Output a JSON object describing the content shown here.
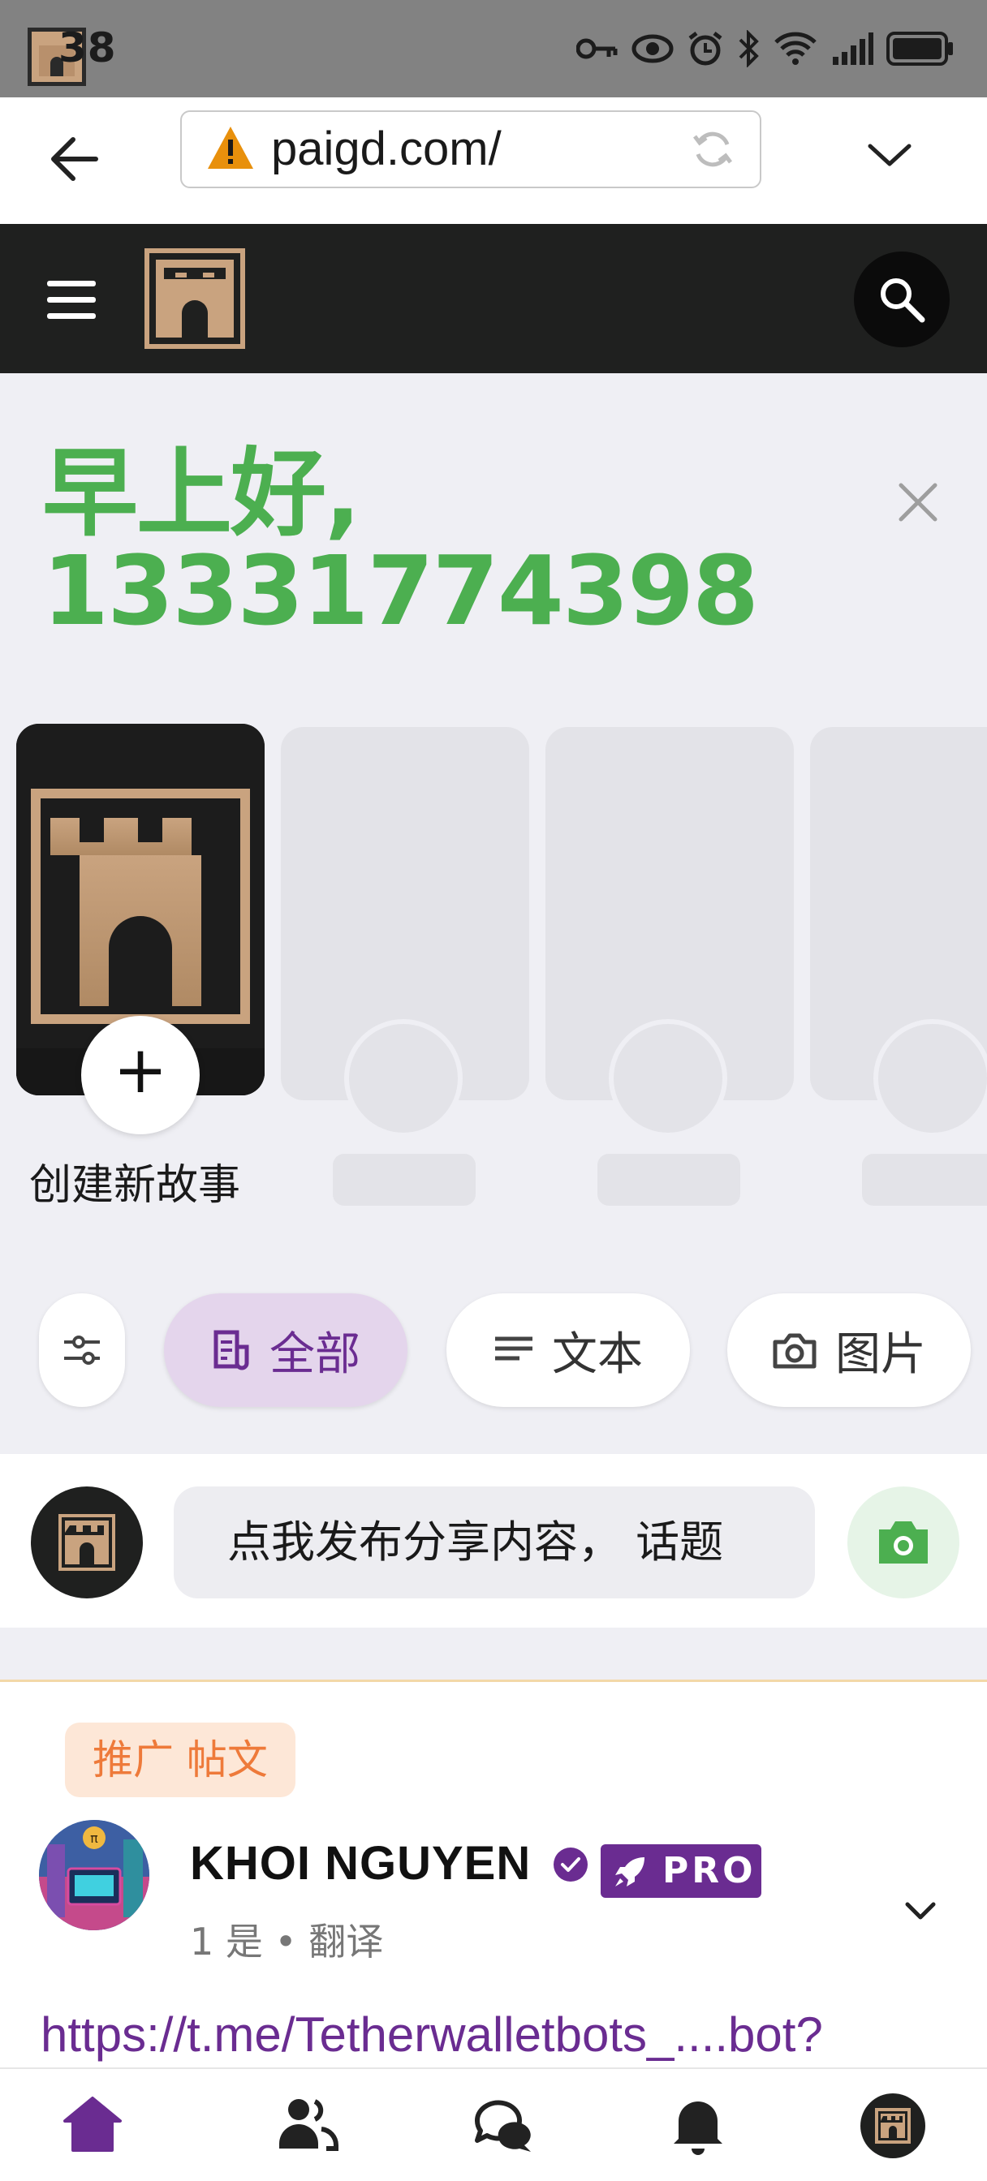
{
  "status_bar": {
    "time": "38"
  },
  "browser": {
    "url": "paigd.com/"
  },
  "greeting": {
    "line1": "早上好,",
    "line2": "13331774398"
  },
  "stories": {
    "create_label": "创建新故事",
    "add_symbol": "+"
  },
  "filters": [
    {
      "label": "全部",
      "icon": "document-icon",
      "active": true
    },
    {
      "label": "文本",
      "icon": "text-lines-icon",
      "active": false
    },
    {
      "label": "图片",
      "icon": "camera-icon",
      "active": false
    }
  ],
  "composer": {
    "placeholder": "点我发布分享内容， 话题"
  },
  "post": {
    "badge": "推广 帖文",
    "author": "KHOI NGUYEN",
    "pro_label": "PRO",
    "meta": "1 是 • 翻译",
    "link": "https://t.me/Tetherwalletbots_....bot?"
  },
  "colors": {
    "accent": "#6a2c91",
    "greeting": "#4caf50",
    "header": "#1f201f",
    "logo": "#c9a37f"
  },
  "nav": [
    "home-icon",
    "friends-icon",
    "chat-icon",
    "bell-icon",
    "profile-avatar"
  ]
}
